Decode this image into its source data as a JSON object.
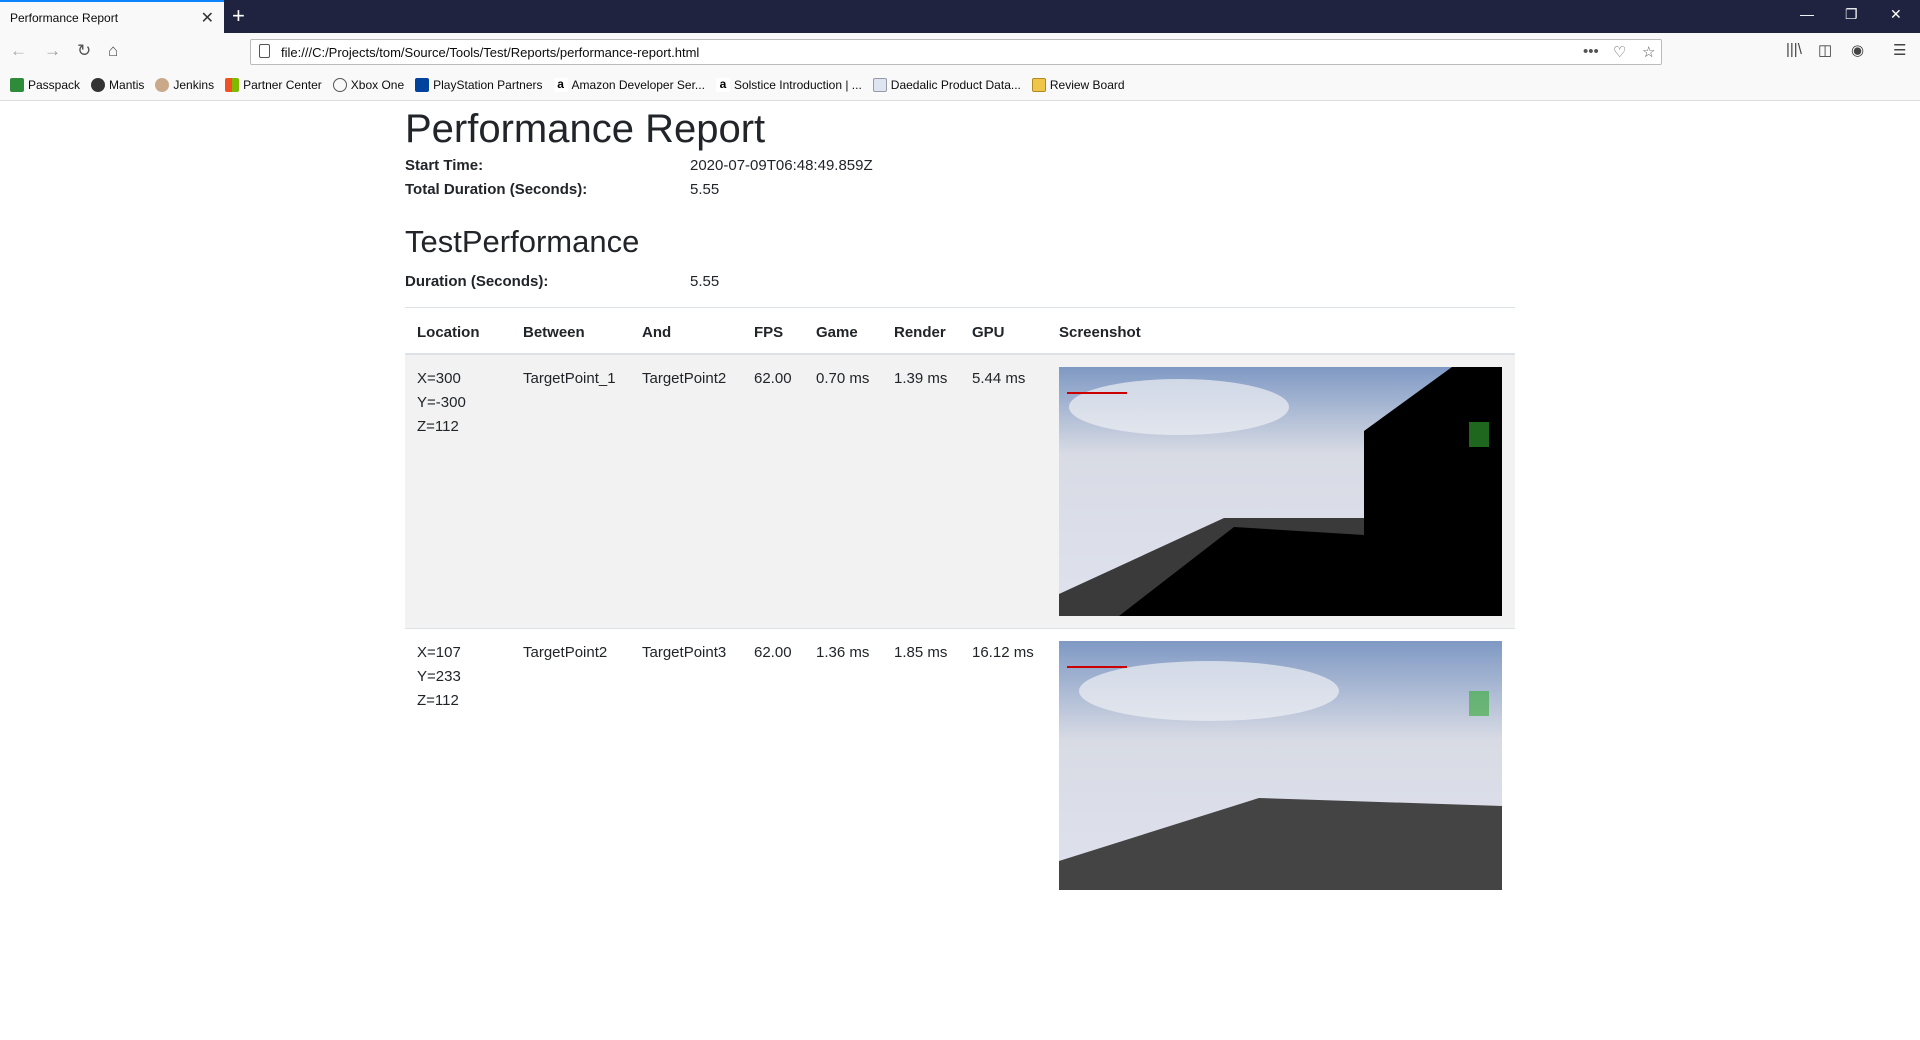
{
  "browser": {
    "tab_title": "Performance Report",
    "url": "file:///C:/Projects/tom/Source/Tools/Test/Reports/performance-report.html",
    "bookmarks": [
      "Passpack",
      "Mantis",
      "Jenkins",
      "Partner Center",
      "Xbox One",
      "PlayStation Partners",
      "Amazon Developer Ser...",
      "Solstice Introduction | ...",
      "Daedalic Product Data...",
      "Review Board"
    ]
  },
  "report": {
    "title": "Performance Report",
    "start_time_label": "Start Time:",
    "start_time": "2020-07-09T06:48:49.859Z",
    "total_duration_label": "Total Duration (Seconds):",
    "total_duration": "5.55",
    "test_name": "TestPerformance",
    "duration_label": "Duration (Seconds):",
    "duration": "5.55"
  },
  "table": {
    "headers": [
      "Location",
      "Between",
      "And",
      "FPS",
      "Game",
      "Render",
      "GPU",
      "Screenshot"
    ],
    "rows": [
      {
        "x": "X=300",
        "y": "Y=-300",
        "z": "Z=112",
        "between": "TargetPoint_1",
        "and": "TargetPoint2",
        "fps": "62.00",
        "game": "0.70 ms",
        "render": "1.39 ms",
        "gpu": "5.44 ms"
      },
      {
        "x": "X=107",
        "y": "Y=233",
        "z": "Z=112",
        "between": "TargetPoint2",
        "and": "TargetPoint3",
        "fps": "62.00",
        "game": "1.36 ms",
        "render": "1.85 ms",
        "gpu": "16.12 ms"
      }
    ]
  }
}
